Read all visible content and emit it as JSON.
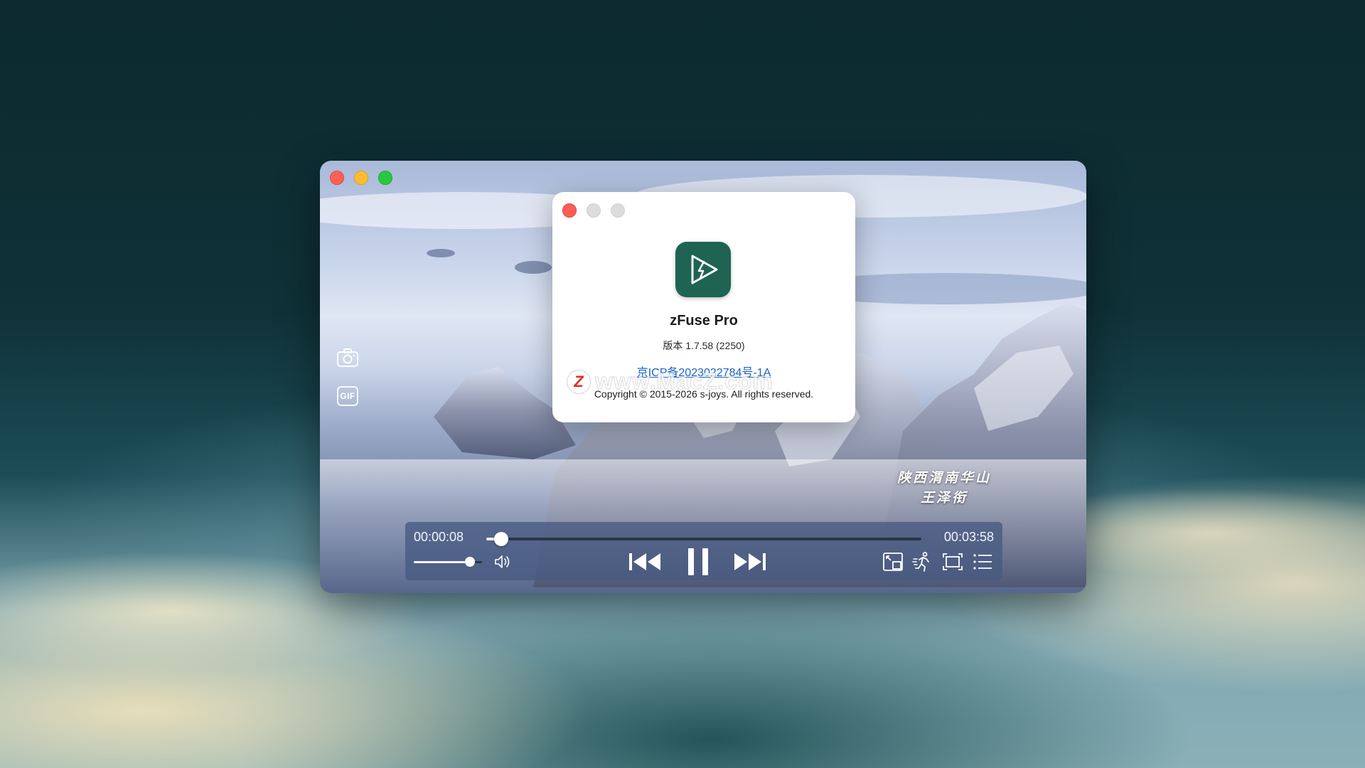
{
  "player": {
    "caption_line1": "陕西渭南华山",
    "caption_line2": "王泽衔",
    "side_tools": {
      "gif_label": "GIF"
    },
    "controls": {
      "current_time": "00:00:08",
      "total_time": "00:03:58",
      "progress": 0.034,
      "volume": 0.82
    }
  },
  "about": {
    "app_name": "zFuse Pro",
    "version": "版本 1.7.58 (2250)",
    "icp_link": "京ICP备2023022784号-1A",
    "copyright": "Copyright © 2015-2026 s-joys. All rights reserved.",
    "watermark": {
      "badge": "Z",
      "text": "www.MacZ.com"
    },
    "icon_color": "#1f6353"
  }
}
